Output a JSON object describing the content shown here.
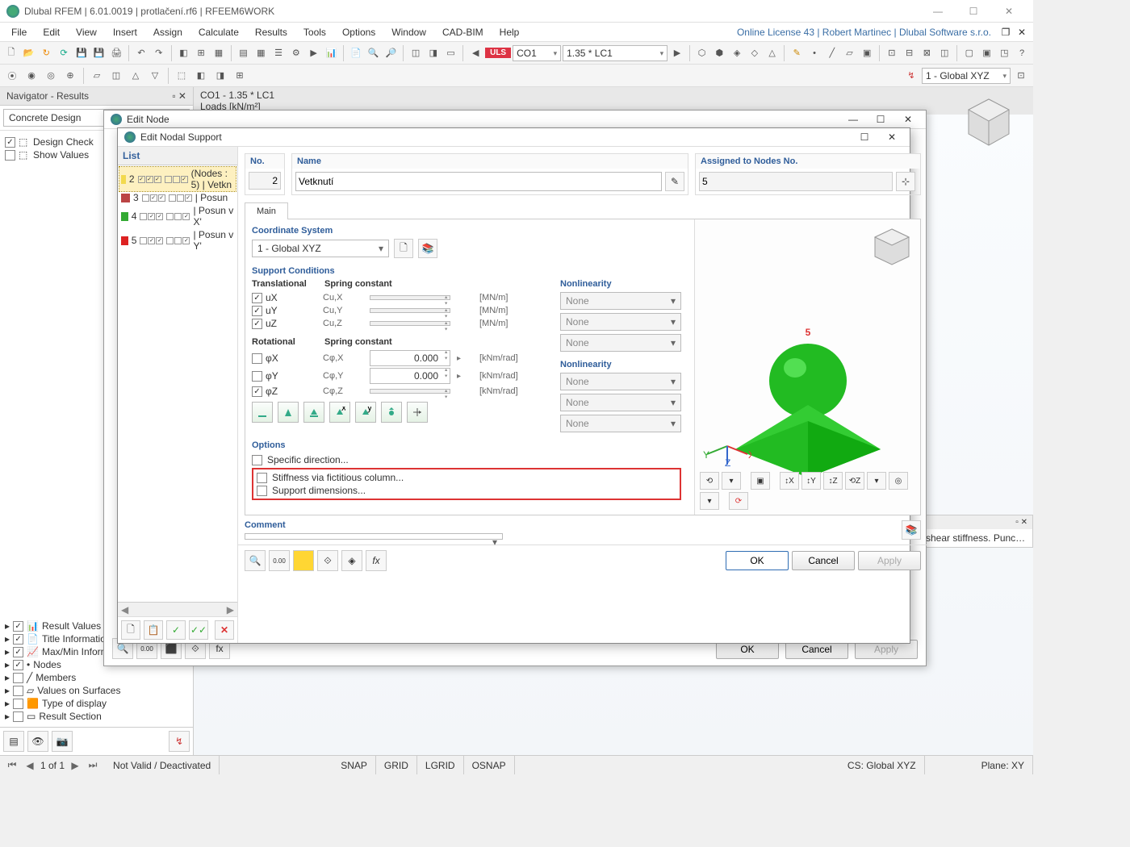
{
  "app": {
    "title": "Dlubal RFEM | 6.01.0019 | protlačení.rf6 | RFEEM6WORK",
    "license": "Online License 43 | Robert Martinec | Dlubal Software s.r.o."
  },
  "menu": [
    "File",
    "Edit",
    "View",
    "Insert",
    "Assign",
    "Calculate",
    "Results",
    "Tools",
    "Options",
    "Window",
    "CAD-BIM",
    "Help"
  ],
  "combo_bar": {
    "uls": "ULS",
    "co": "CO1",
    "factor": "1.35 * LC1",
    "cs": "1 - Global XYZ"
  },
  "navigator": {
    "title": "Navigator - Results",
    "dropdown": "Concrete Design",
    "items": [
      {
        "checked": true,
        "label": "Design Check"
      },
      {
        "checked": false,
        "label": "Show Values"
      }
    ],
    "tree": [
      {
        "checked": true,
        "label": "Result Values"
      },
      {
        "checked": true,
        "label": "Title Information"
      },
      {
        "checked": true,
        "label": "Max/Min Information"
      },
      {
        "checked": true,
        "label": "Nodes"
      },
      {
        "checked": false,
        "label": "Members"
      },
      {
        "checked": false,
        "label": "Values on Surfaces"
      },
      {
        "checked": false,
        "label": "Type of display"
      },
      {
        "checked": false,
        "label": "Result Section"
      }
    ]
  },
  "view3d": {
    "header": "CO1 - 1.35 * LC1",
    "sub": "Loads [kN/m²]"
  },
  "panel_right": {
    "text": "shear stiffness. Punch ..."
  },
  "parent_dialog": {
    "title": "Edit Node",
    "ok": "OK",
    "cancel": "Cancel",
    "apply": "Apply"
  },
  "dialog": {
    "title": "Edit Nodal Support",
    "list_header": "List",
    "list": [
      {
        "n": "2",
        "color": "#f2d94e",
        "sel": true,
        "label": "(Nodes : 5) | Vetkn"
      },
      {
        "n": "3",
        "color": "#b44",
        "sel": false,
        "label": "| Posun"
      },
      {
        "n": "4",
        "color": "#3a3",
        "sel": false,
        "label": "| Posun v X'"
      },
      {
        "n": "5",
        "color": "#d22",
        "sel": false,
        "label": "| Posun v Y'"
      }
    ],
    "no_hdr": "No.",
    "no": "2",
    "name_hdr": "Name",
    "name": "Vetknutí",
    "assign_hdr": "Assigned to Nodes No.",
    "assign": "5",
    "tab": "Main",
    "coord_hdr": "Coordinate System",
    "coord": "1 - Global XYZ",
    "support_hdr": "Support Conditions",
    "col_trans": "Translational",
    "col_spring": "Spring constant",
    "col_nl": "Nonlinearity",
    "col_rot": "Rotational",
    "rows_t": [
      {
        "on": true,
        "lbl": "uX",
        "c": "Cu,X",
        "unit": "[MN/m]",
        "nl": "None"
      },
      {
        "on": true,
        "lbl": "uY",
        "c": "Cu,Y",
        "unit": "[MN/m]",
        "nl": "None"
      },
      {
        "on": true,
        "lbl": "uZ",
        "c": "Cu,Z",
        "unit": "[MN/m]",
        "nl": "None"
      }
    ],
    "rows_r": [
      {
        "on": false,
        "lbl": "φX",
        "c": "Cφ,X",
        "v": "0.000",
        "unit": "[kNm/rad]",
        "nl": "None"
      },
      {
        "on": false,
        "lbl": "φY",
        "c": "Cφ,Y",
        "v": "0.000",
        "unit": "[kNm/rad]",
        "nl": "None"
      },
      {
        "on": true,
        "lbl": "φZ",
        "c": "Cφ,Z",
        "unit": "[kNm/rad]",
        "nl": "None"
      }
    ],
    "options_hdr": "Options",
    "options": [
      {
        "label": "Specific direction..."
      },
      {
        "label": "Stiffness via fictitious column..."
      },
      {
        "label": "Support dimensions..."
      }
    ],
    "comment_hdr": "Comment",
    "ok": "OK",
    "cancel": "Cancel",
    "apply": "Apply"
  },
  "status": {
    "page": "1 of 1",
    "valid": "Not Valid / Deactivated",
    "snap": "SNAP",
    "grid": "GRID",
    "lgrid": "LGRID",
    "osnap": "OSNAP",
    "cs": "CS: Global XYZ",
    "plane": "Plane: XY"
  }
}
